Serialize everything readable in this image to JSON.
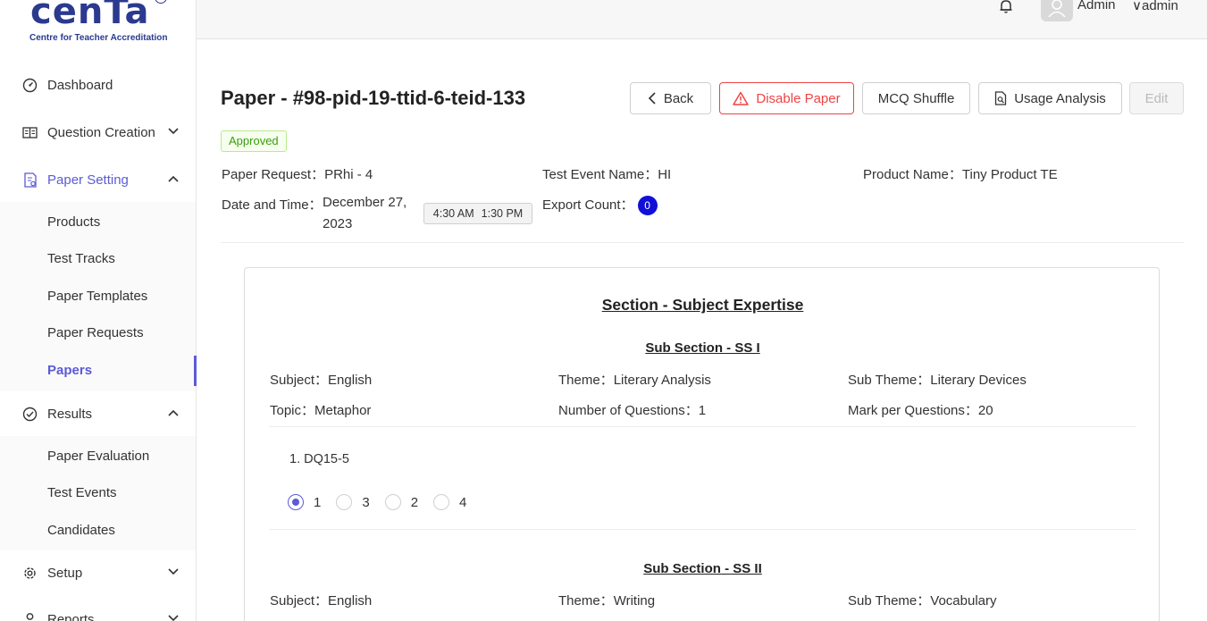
{
  "logo": {
    "word": "cenTa",
    "reg": "R",
    "subtitle": "Centre for Teacher Accreditation"
  },
  "sidebar": {
    "items": [
      {
        "label": "Dashboard"
      },
      {
        "label": "Question Creation"
      },
      {
        "label": "Paper Setting"
      },
      {
        "label": "Results"
      },
      {
        "label": "Setup"
      },
      {
        "label": "Reports"
      }
    ],
    "paper_setting_sub": [
      "Products",
      "Test Tracks",
      "Paper Templates",
      "Paper Requests",
      "Papers"
    ],
    "results_sub": [
      "Paper Evaluation",
      "Test Events",
      "Candidates"
    ]
  },
  "header": {
    "user_name": "Admin",
    "user_menu": "∨admin"
  },
  "page": {
    "title": "Paper - #98-pid-19-ttid-6-teid-133",
    "status": "Approved",
    "buttons": {
      "back": "Back",
      "disable": "Disable Paper",
      "shuffle": "MCQ Shuffle",
      "usage": "Usage Analysis",
      "edit": "Edit"
    },
    "meta": {
      "paper_request_label": "Paper Request：",
      "paper_request": "PRhi - 4",
      "test_event_label": "Test Event Name：",
      "test_event": "HI",
      "product_label": "Product Name：",
      "product": "Tiny Product TE",
      "date_label": "Date and Time：",
      "date_line1": "December 27,",
      "date_line2": "2023",
      "time_start": "4:30 AM",
      "time_end": "1:30 PM",
      "export_label": "Export Count：",
      "export_count": "0"
    }
  },
  "section": {
    "title": "Section - Subject Expertise",
    "subsections": [
      {
        "title": "Sub Section - SS I",
        "subject_label": "Subject：",
        "subject": "English",
        "theme_label": "Theme：",
        "theme": "Literary Analysis",
        "subtheme_label": "Sub Theme：",
        "subtheme": "Literary Devices",
        "topic_label": "Topic：",
        "topic": "Metaphor",
        "numq_label": "Number of Questions：",
        "numq": "1",
        "mark_label": "Mark per Questions：",
        "mark": "20",
        "question": "1. DQ15-5",
        "options": [
          "1",
          "3",
          "2",
          "4"
        ],
        "selected": "1"
      },
      {
        "title": "Sub Section - SS II",
        "subject_label": "Subject：",
        "subject": "English",
        "theme_label": "Theme：",
        "theme": "Writing",
        "subtheme_label": "Sub Theme：",
        "subtheme": "Vocabulary"
      }
    ]
  }
}
